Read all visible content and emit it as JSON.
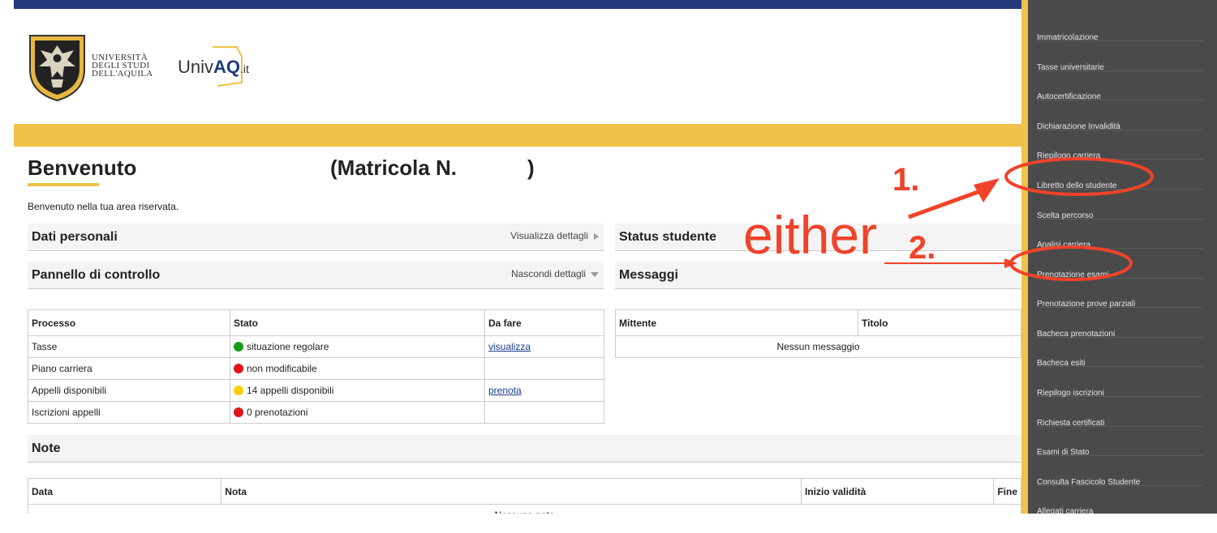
{
  "header": {
    "university_name": [
      "UNIVERSITÀ",
      "DEGLI STUDI",
      "DELL'AQUILA"
    ],
    "univaq_brand": "UnivAQ",
    "univaq_brand_main": "Univ",
    "univaq_brand_bold": "AQ",
    "univaq_brand_suffix": ".it"
  },
  "welcome": {
    "title": "Benvenuto",
    "matricola_label": "(Matricola N.",
    "matricola_close": ")",
    "text": "Benvenuto nella tua area riservata."
  },
  "panels": {
    "dati_personali": {
      "title": "Dati personali",
      "action": "Visualizza dettagli"
    },
    "pannello": {
      "title": "Pannello di controllo",
      "action": "Nascondi dettagli"
    },
    "status": {
      "title": "Status studente"
    },
    "messaggi": {
      "title": "Messaggi"
    },
    "note": {
      "title": "Note"
    }
  },
  "process_table": {
    "headers": [
      "Processo",
      "Stato",
      "Da fare"
    ],
    "rows": [
      {
        "processo": "Tasse",
        "stato": "situazione regolare",
        "status_color": "#1a9a1a",
        "da_fare": "visualizza"
      },
      {
        "processo": "Piano carriera",
        "stato": "non modificabile",
        "status_color": "#e0141a",
        "da_fare": ""
      },
      {
        "processo": "Appelli disponibili",
        "stato": "14 appelli disponibili",
        "status_color": "#f5d000",
        "da_fare": "prenota"
      },
      {
        "processo": "Iscrizioni appelli",
        "stato": "0 prenotazioni",
        "status_color": "#e0141a",
        "da_fare": ""
      }
    ]
  },
  "messages_table": {
    "headers": [
      "Mittente",
      "Titolo"
    ],
    "empty": "Nessun messaggio"
  },
  "notes_table": {
    "headers": [
      "Data",
      "Nota",
      "Inizio validità",
      "Fine"
    ],
    "empty": "Nessuna nota"
  },
  "sidebar": {
    "items": [
      "Immatricolazione",
      "Tasse universitarie",
      "Autocertificazione",
      "Dichiarazione Invalidità",
      "Riepilogo carriera",
      "Libretto dello studente",
      "Scelta percorso",
      "Analisi carriera",
      "Prenotazione esami",
      "Prenotazione prove parziali",
      "Bacheca prenotazioni",
      "Bacheca esiti",
      "Riepilogo iscrizioni",
      "Richiesta certificati",
      "Esami di Stato",
      "Consulta Fascicolo Studente",
      "Allegati carriera"
    ]
  },
  "annotations": {
    "label_1": "1.",
    "label_2": "2.",
    "either": "either",
    "color": "#f0432a"
  },
  "colors": {
    "topbar": "#253a7d",
    "accent_yellow": "#f0c24a",
    "sidebar_bg": "#4a4a4a"
  }
}
